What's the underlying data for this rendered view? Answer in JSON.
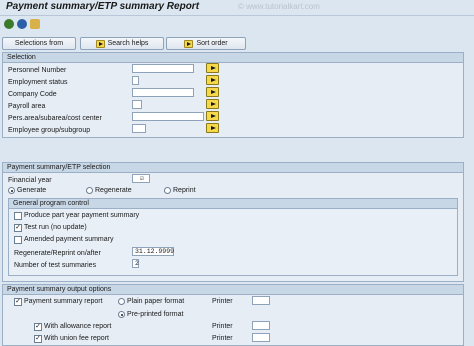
{
  "title": "Payment summary/ETP summary Report",
  "watermark": "© www.tutorialkart.com",
  "toolbar": {
    "selections_from": "Selections from",
    "search_helps": "Search helps",
    "sort_order": "Sort order"
  },
  "selection": {
    "header": "Selection",
    "rows": [
      {
        "label": "Personnel Number"
      },
      {
        "label": "Employment status"
      },
      {
        "label": "Company Code"
      },
      {
        "label": "Payroll area"
      },
      {
        "label": "Pers.area/subarea/cost center"
      },
      {
        "label": "Employee group/subgroup"
      }
    ]
  },
  "ps_selection": {
    "header": "Payment summary/ETP selection",
    "financial_year_label": "Financial year",
    "generate": "Generate",
    "regenerate": "Regenerate",
    "reprint": "Reprint"
  },
  "general_control": {
    "header": "General program control",
    "produce_part_year": "Produce part year payment summary",
    "test_run": "Test run (no update)",
    "amended": "Amended payment summary",
    "regen_label": "Regenerate/Reprint on/after",
    "regen_value": "31.12.9999",
    "num_test_label": "Number of test summaries",
    "num_test_value": "2"
  },
  "output_options": {
    "header": "Payment summary output options",
    "payment_summary_report": "Payment summary report",
    "plain_paper": "Plain paper format",
    "preprinted": "Pre-printed format",
    "printer_label": "Printer",
    "with_allowance": "With allowance report",
    "with_union_fee": "With union fee report"
  }
}
